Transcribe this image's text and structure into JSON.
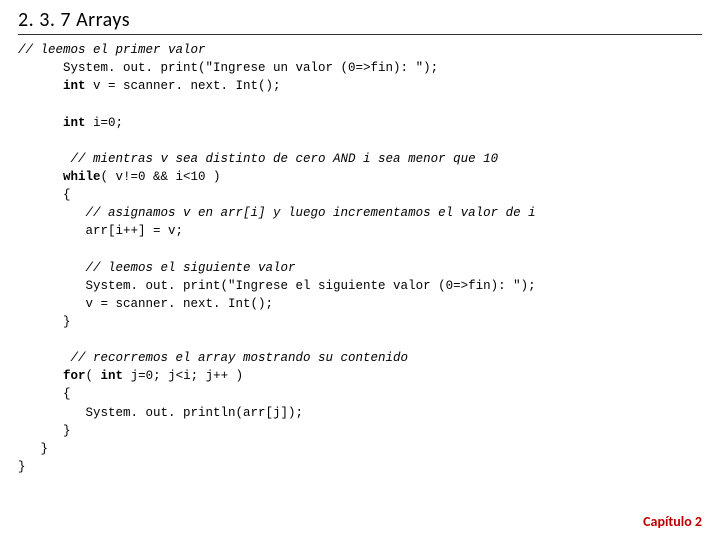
{
  "heading": "2. 3. 7 Arrays",
  "code": {
    "c1": "// leemos el primer valor",
    "l1": "      System. out. print(\"Ingrese un valor (0=>fin): \");",
    "l2a": "      ",
    "kw_int1": "int",
    "l2b": " v = scanner. next. Int();",
    "l3a": "      ",
    "kw_int2": "int",
    "l3b": " i=0;",
    "c2": "       // mientras v sea distinto de cero AND i sea menor que 10",
    "l4a": "      ",
    "kw_while": "while",
    "l4b": "( v!=0 && i<10 )",
    "l5": "      {",
    "c3": "         // asignamos v en arr[i] y luego incrementamos el valor de i",
    "l6": "         arr[i++] = v;",
    "c4": "         // leemos el siguiente valor",
    "l7": "         System. out. print(\"Ingrese el siguiente valor (0=>fin): \");",
    "l8": "         v = scanner. next. Int();",
    "l9": "      }",
    "c5": "       // recorremos el array mostrando su contenido",
    "l10a": "      ",
    "kw_for": "for",
    "l10b": "( ",
    "kw_int3": "int",
    "l10c": " j=0; j<i; j++ )",
    "l11": "      {",
    "l12": "         System. out. println(arr[j]);",
    "l13": "      }",
    "l14": "   }",
    "l15": "}"
  },
  "footer": "Capítulo 2"
}
